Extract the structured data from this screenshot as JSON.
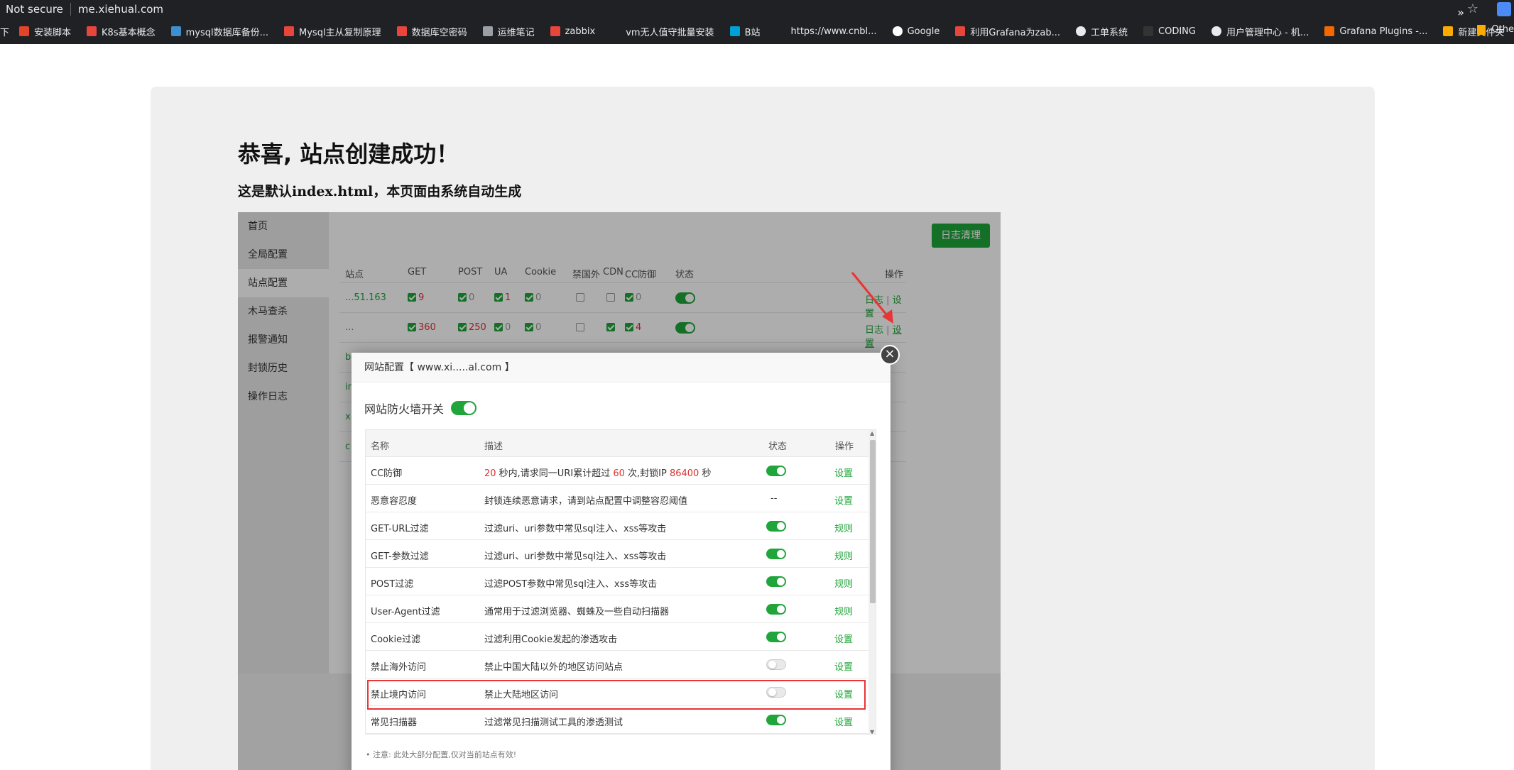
{
  "browser": {
    "not_secure": "Not secure",
    "url": "me.xiehual.com",
    "bookmark_first": "下",
    "bookmarks": [
      {
        "label": "安装脚本",
        "icon": "gitlab-icon",
        "color": "#e24329"
      },
      {
        "label": "K8s基本概念",
        "icon": "csdn-icon",
        "color": "#e8453c"
      },
      {
        "label": "mysql数据库备份...",
        "icon": "bookmark-icon",
        "color": "#3e8ed0"
      },
      {
        "label": "Mysql主从复制原理",
        "icon": "csdn-icon",
        "color": "#e8453c"
      },
      {
        "label": "数据库空密码",
        "icon": "csdn-icon",
        "color": "#e8453c"
      },
      {
        "label": "运维笔记",
        "icon": "note-icon",
        "color": "#9aa0a6"
      },
      {
        "label": "zabbix",
        "icon": "csdn-icon",
        "color": "#e8453c"
      },
      {
        "label": "vm无人值守批量安装",
        "icon": "",
        "color": "#202124"
      },
      {
        "label": "B站",
        "icon": "bilibili-icon",
        "color": "#00a1d6"
      },
      {
        "label": "https://www.cnbl...",
        "icon": "",
        "color": "#202124"
      },
      {
        "label": "Google",
        "icon": "google-icon",
        "color": "#ffffff"
      },
      {
        "label": "利用Grafana为zab...",
        "icon": "jianshu-icon",
        "color": "#e8453c"
      },
      {
        "label": "工单系统",
        "icon": "globe-icon",
        "color": "#e8eaed"
      },
      {
        "label": "CODING",
        "icon": "coding-icon",
        "color": "#333333"
      },
      {
        "label": "用户管理中心 - 机...",
        "icon": "globe-icon",
        "color": "#e8eaed"
      },
      {
        "label": "Grafana Plugins -...",
        "icon": "grafana-icon",
        "color": "#f46800"
      },
      {
        "label": "新建文件夹",
        "icon": "folder-icon",
        "color": "#f9ab00"
      }
    ],
    "more": "»",
    "other": "Othe"
  },
  "page": {
    "title": "恭喜, 站点创建成功！",
    "subtitle": "这是默认index.html，本页面由系统自动生成"
  },
  "app": {
    "sidebar": [
      "首页",
      "全局配置",
      "站点配置",
      "木马查杀",
      "报警通知",
      "封锁历史",
      "操作日志"
    ],
    "log_clear_button": "日志清理",
    "site_columns": [
      "站点",
      "GET",
      "POST",
      "UA",
      "Cookie",
      "禁国外",
      "CDN",
      "CC防御",
      "状态",
      "操作"
    ],
    "site_rows": [
      {
        "site": "...51.163",
        "get": "9",
        "post": "0",
        "ua": "1",
        "cookie": "0",
        "cc": "0"
      },
      {
        "site": "...",
        "get": "360",
        "post": "250",
        "ua": "0",
        "cookie": "0",
        "cc": "4"
      }
    ],
    "row_ops_log": "日志",
    "row_ops_sep": " | ",
    "row_ops_set": "设置",
    "hidden_sites": [
      "b",
      "in",
      "x",
      "c"
    ]
  },
  "modal": {
    "title": "网站配置【 www.xi.....al.com 】",
    "firewall_label": "网站防火墙开关",
    "columns": {
      "name": "名称",
      "desc": "描述",
      "status": "状态",
      "op": "操作"
    },
    "rules": [
      {
        "name": "CC防御",
        "desc_parts": [
          "20",
          " 秒内,请求同一URI累计超过 ",
          "60",
          " 次,封锁IP ",
          "86400",
          " 秒"
        ],
        "status": "on",
        "op": "设置"
      },
      {
        "name": "恶意容忍度",
        "desc": "封锁连续恶意请求，请到站点配置中调整容忍阈值",
        "status": "--",
        "op": "设置"
      },
      {
        "name": "GET-URL过滤",
        "desc": "过滤uri、uri参数中常见sql注入、xss等攻击",
        "status": "on",
        "op": "规则"
      },
      {
        "name": "GET-参数过滤",
        "desc": "过滤uri、uri参数中常见sql注入、xss等攻击",
        "status": "on",
        "op": "规则"
      },
      {
        "name": "POST过滤",
        "desc": "过滤POST参数中常见sql注入、xss等攻击",
        "status": "on",
        "op": "规则"
      },
      {
        "name": "User-Agent过滤",
        "desc": "通常用于过滤浏览器、蜘蛛及一些自动扫描器",
        "status": "on",
        "op": "规则"
      },
      {
        "name": "Cookie过滤",
        "desc": "过滤利用Cookie发起的渗透攻击",
        "status": "on",
        "op": "设置"
      },
      {
        "name": "禁止海外访问",
        "desc": "禁止中国大陆以外的地区访问站点",
        "status": "off",
        "op": "设置"
      },
      {
        "name": "禁止境内访问",
        "desc": "禁止大陆地区访问",
        "status": "off",
        "op": "设置"
      },
      {
        "name": "常见扫描器",
        "desc": "过滤常见扫描测试工具的渗透测试",
        "status": "on",
        "op": "设置"
      }
    ],
    "note": "注意: 此处大部分配置,仅对当前站点有效!"
  },
  "colors": {
    "green": "#20a53a",
    "red": "#e03030",
    "highlight": "#e83535"
  }
}
